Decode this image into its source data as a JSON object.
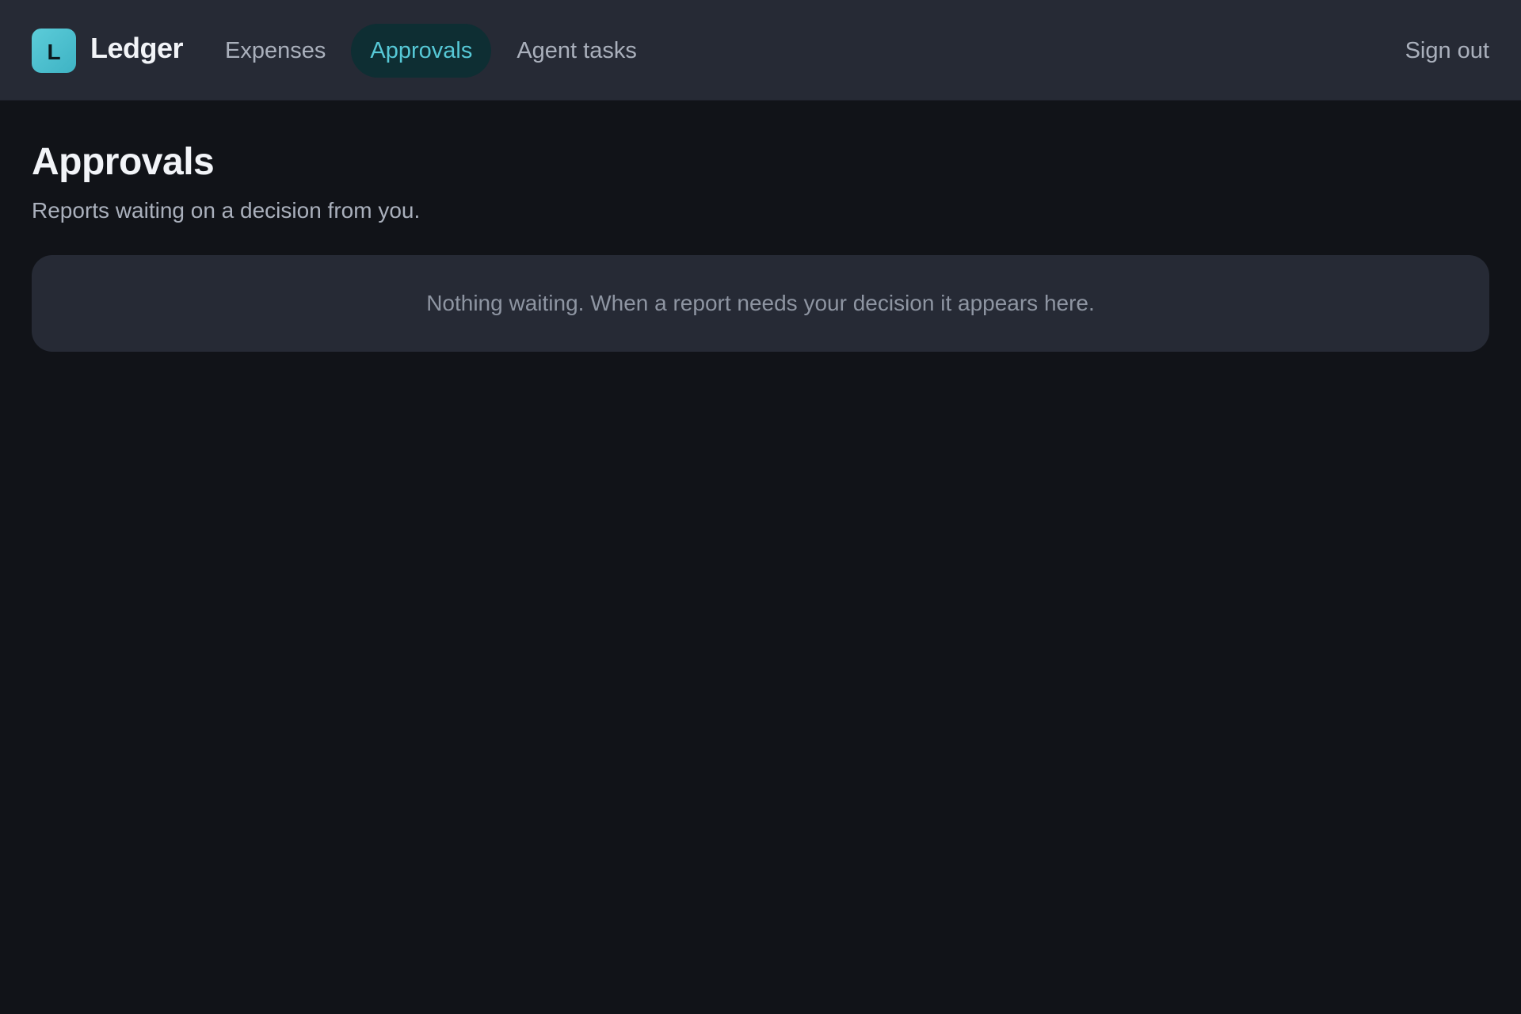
{
  "brand": {
    "logo_letter": "L",
    "name": "Ledger"
  },
  "nav": {
    "items": [
      {
        "label": "Expenses",
        "active": false
      },
      {
        "label": "Approvals",
        "active": true
      },
      {
        "label": "Agent tasks",
        "active": false
      }
    ]
  },
  "header": {
    "sign_out_label": "Sign out"
  },
  "main": {
    "title": "Approvals",
    "subtitle": "Reports waiting on a decision from you.",
    "empty_message": "Nothing waiting. When a report needs your decision it appears here."
  },
  "colors": {
    "background": "#111318",
    "surface": "#262a35",
    "accent": "#56c8d6",
    "accent_bg": "#0e2e33",
    "muted_text": "#aab0bc"
  }
}
